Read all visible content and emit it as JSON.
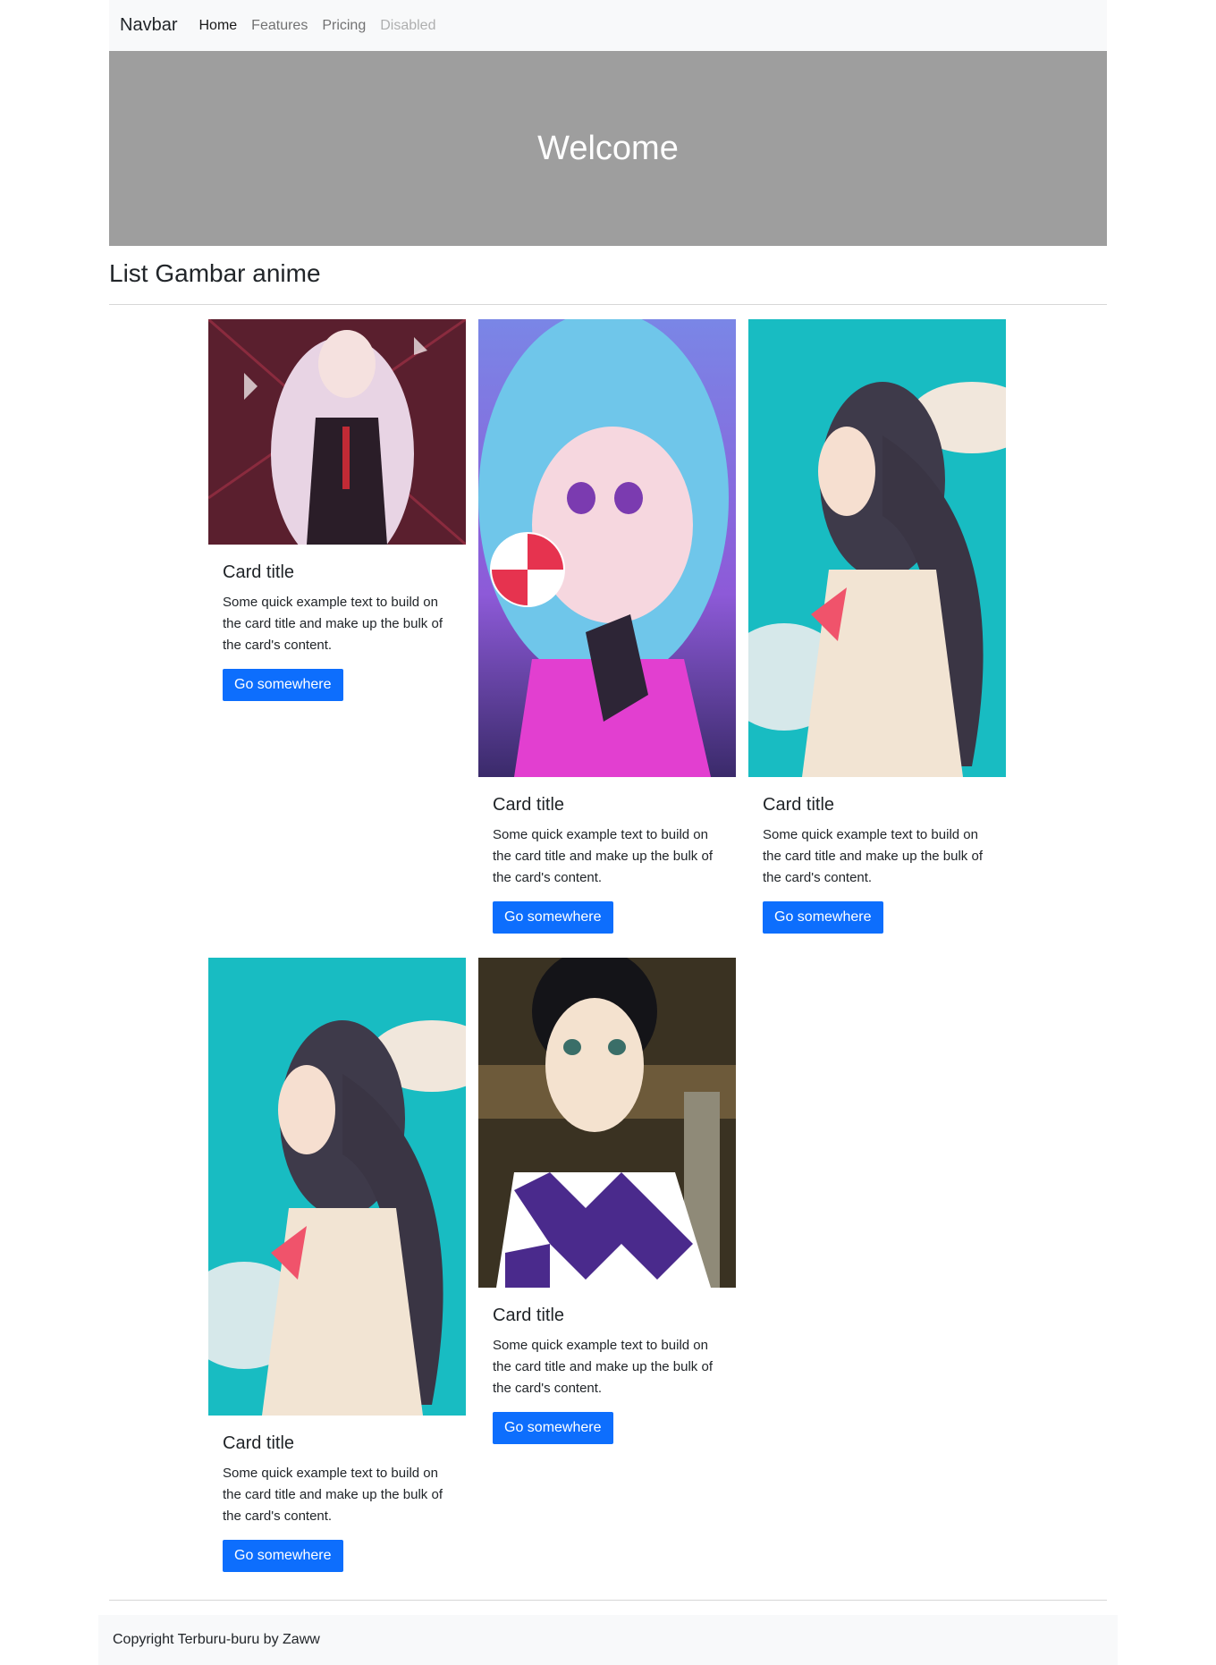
{
  "navbar": {
    "brand": "Navbar",
    "links": [
      {
        "label": "Home"
      },
      {
        "label": "Features"
      },
      {
        "label": "Pricing"
      },
      {
        "label": "Disabled"
      }
    ]
  },
  "hero": {
    "title": "Welcome"
  },
  "section": {
    "title": "List Gambar anime"
  },
  "cards": [
    {
      "title": "Card title",
      "text": "Some quick example text to build on the card title and make up the bulk of the card's content.",
      "button": "Go somewhere",
      "image": "anime-girl-white-hair"
    },
    {
      "title": "Card title",
      "text": "Some quick example text to build on the card title and make up the bulk of the card's content.",
      "button": "Go somewhere",
      "image": "anime-girl-blue-hair-lollipop"
    },
    {
      "title": "Card title",
      "text": "Some quick example text to build on the card title and make up the bulk of the card's content.",
      "button": "Go somewhere",
      "image": "anime-girl-sailor-uniform-sky"
    },
    {
      "title": "Card title",
      "text": "Some quick example text to build on the card title and make up the bulk of the card's content.",
      "button": "Go somewhere",
      "image": "anime-girl-sailor-uniform-sky"
    },
    {
      "title": "Card title",
      "text": "Some quick example text to build on the card title and make up the bulk of the card's content.",
      "button": "Go somewhere",
      "image": "anime-girl-checkered-kimono"
    }
  ],
  "footer": {
    "text": "Copyright Terburu-buru by Zaww"
  },
  "colors": {
    "primary": "#0d6efd",
    "hero_bg": "#9e9e9e",
    "navbar_bg": "#f8f9fa"
  }
}
